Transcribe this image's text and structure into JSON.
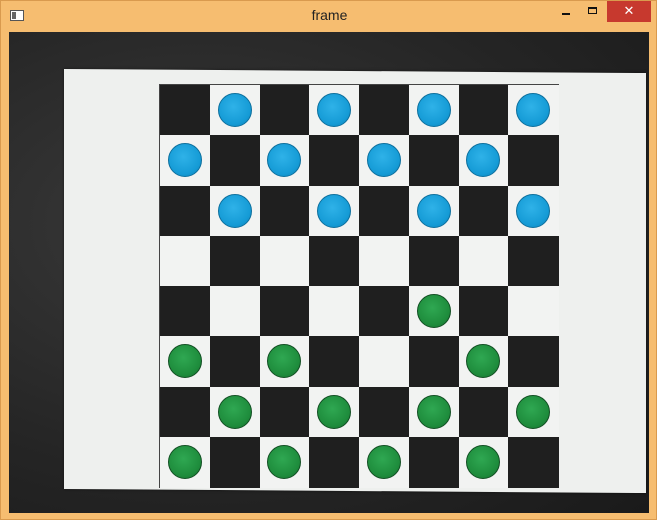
{
  "window": {
    "title": "frame",
    "close_label": "✕"
  },
  "board": {
    "rows": 8,
    "cols": 8,
    "pieces": [
      {
        "color": "blue",
        "row": 0,
        "col": 1
      },
      {
        "color": "blue",
        "row": 0,
        "col": 3
      },
      {
        "color": "blue",
        "row": 0,
        "col": 5
      },
      {
        "color": "blue",
        "row": 0,
        "col": 7
      },
      {
        "color": "blue",
        "row": 1,
        "col": 0
      },
      {
        "color": "blue",
        "row": 1,
        "col": 2
      },
      {
        "color": "blue",
        "row": 1,
        "col": 4
      },
      {
        "color": "blue",
        "row": 1,
        "col": 6
      },
      {
        "color": "blue",
        "row": 2,
        "col": 1
      },
      {
        "color": "blue",
        "row": 2,
        "col": 3
      },
      {
        "color": "blue",
        "row": 2,
        "col": 5
      },
      {
        "color": "blue",
        "row": 2,
        "col": 7
      },
      {
        "color": "green",
        "row": 4,
        "col": 5
      },
      {
        "color": "green",
        "row": 5,
        "col": 0
      },
      {
        "color": "green",
        "row": 5,
        "col": 2
      },
      {
        "color": "green",
        "row": 5,
        "col": 6
      },
      {
        "color": "green",
        "row": 6,
        "col": 1
      },
      {
        "color": "green",
        "row": 6,
        "col": 3
      },
      {
        "color": "green",
        "row": 6,
        "col": 5
      },
      {
        "color": "green",
        "row": 6,
        "col": 7
      },
      {
        "color": "green",
        "row": 7,
        "col": 0
      },
      {
        "color": "green",
        "row": 7,
        "col": 2
      },
      {
        "color": "green",
        "row": 7,
        "col": 4
      },
      {
        "color": "green",
        "row": 7,
        "col": 6
      }
    ]
  }
}
